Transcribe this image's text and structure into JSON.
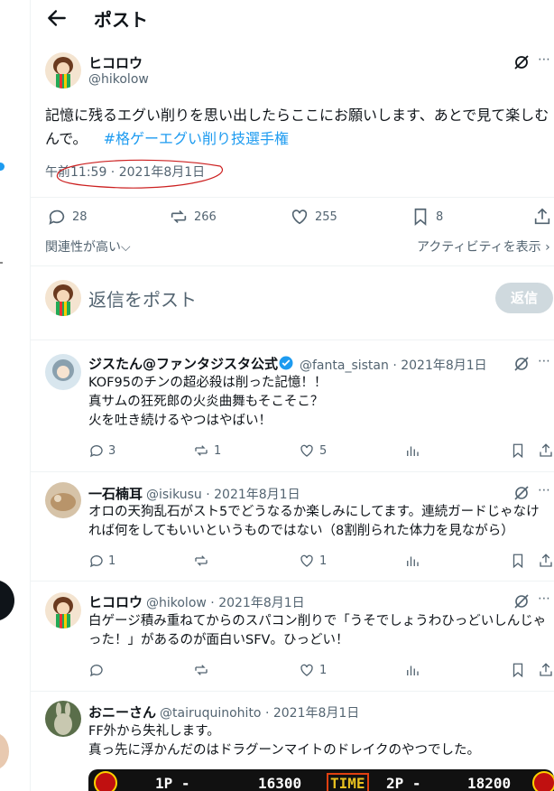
{
  "header": {
    "title": "ポスト"
  },
  "post": {
    "name": "ヒコロウ",
    "handle": "@hikolow",
    "text": "記憶に残るエグい削りを思い出したらここにお願いします、あとで見て楽しむんで。",
    "hashtag": "#格ゲーエグい削り技選手権",
    "timestamp": "午前11:59 · 2021年8月1日",
    "replies": "28",
    "reposts": "266",
    "likes": "255",
    "bookmarks": "8"
  },
  "sort": {
    "left": "関連性が高い",
    "right": "アクティビティを表示"
  },
  "compose": {
    "placeholder": "返信をポスト",
    "button": "返信"
  },
  "replies": [
    {
      "name": "ジスたん@ファンタジスタ公式",
      "handle": "@fanta_sistan",
      "date": "· 2021年8月1日",
      "text": "KOF95のチンの超必殺は削った記憶！！\n真サムの狂死郎の火炎曲舞もそこそこ？\n火を吐き続けるやつはやばい！",
      "replies": "3",
      "reposts": "1",
      "likes": "5"
    },
    {
      "name": "一石楠耳",
      "handle": "@isikusu",
      "date": "· 2021年8月1日",
      "text": "オロの天狗乱石がスト5でどうなるか楽しみにしてます。連続ガードじゃなければ何をしてもいいというものではない（8割削られた体力を見ながら）",
      "replies": "1",
      "reposts": "",
      "likes": "1"
    },
    {
      "name": "ヒコロウ",
      "handle": "@hikolow",
      "date": "· 2021年8月1日",
      "text": "白ゲージ積み重ねてからのスパコン削りで「うそでしょうわひっどいしんじゃった！」があるのが面白いSFV。ひっどい！",
      "replies": "",
      "reposts": "",
      "likes": "1"
    },
    {
      "name": "おニーさん",
      "handle": "@tairuquinohito",
      "date": "· 2021年8月1日",
      "text": "FF外から失礼します。\n真っ先に浮かんだのはドラグーンマイトのドレイクのやつでした。",
      "media": {
        "p1": "1P -",
        "score1": "16300",
        "time": "TIME",
        "p2": "2P -",
        "score2": "18200"
      }
    }
  ],
  "colors": {
    "accent": "#1d9bf0",
    "text": "#0f1419",
    "muted": "#536471",
    "ellipse": "#cc2020"
  },
  "icons": [
    "back-arrow-icon",
    "grok-icon",
    "more-icon",
    "reply-icon",
    "repost-icon",
    "like-icon",
    "bookmark-icon",
    "share-icon",
    "views-icon",
    "verified-badge-icon",
    "chevron-down-icon"
  ]
}
